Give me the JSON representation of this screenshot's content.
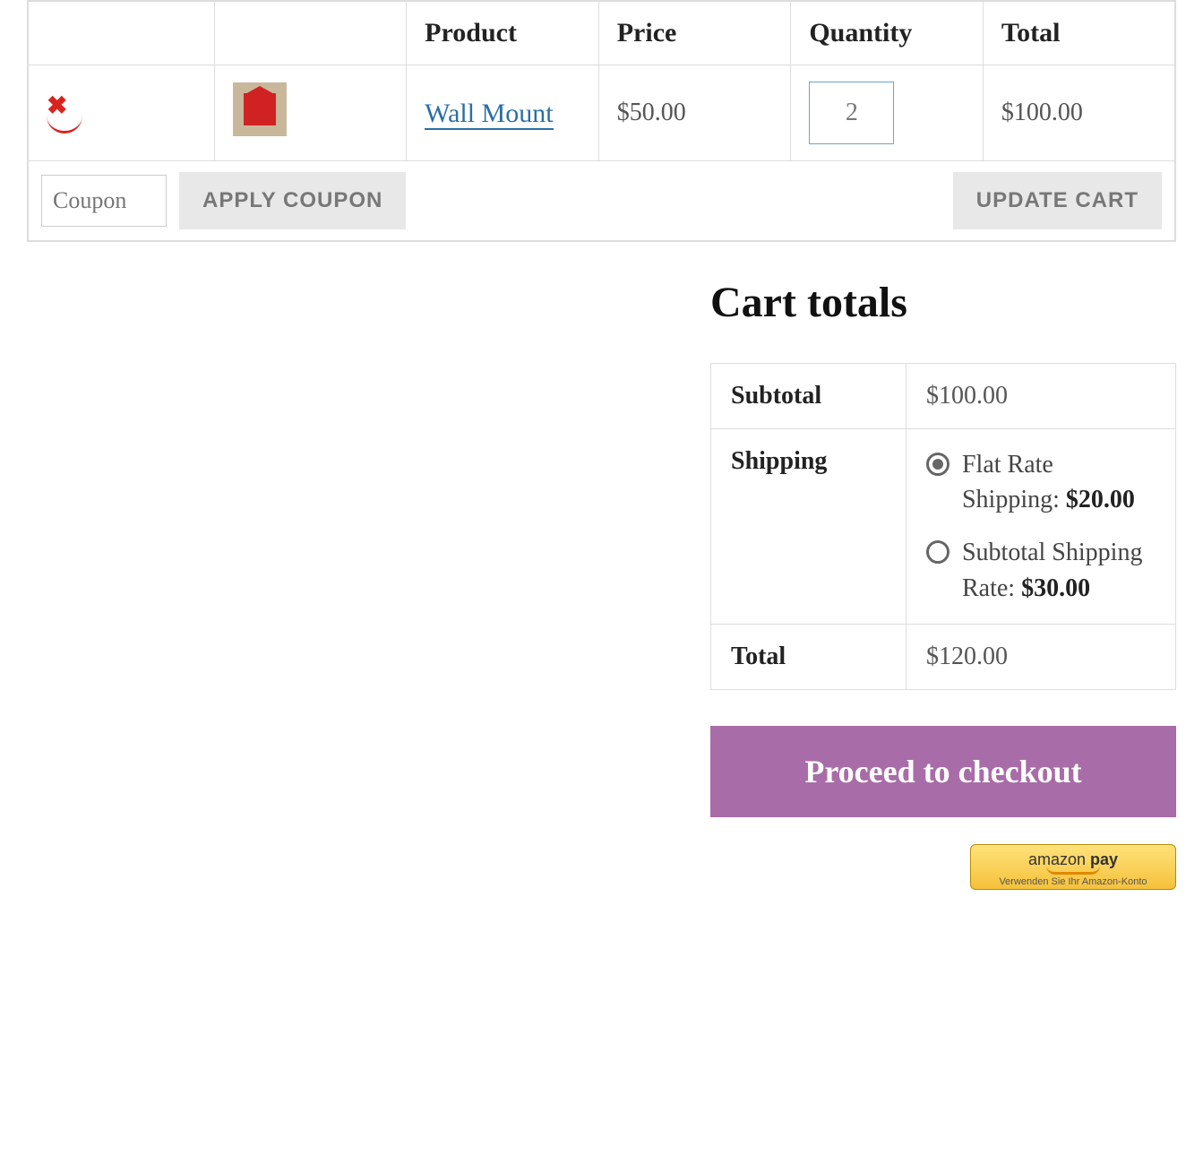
{
  "cart_table": {
    "headers": {
      "product": "Product",
      "price": "Price",
      "quantity": "Quantity",
      "total": "Total"
    },
    "item": {
      "remove_symbol": "✖",
      "product_name": "Wall Mount",
      "price": "$50.00",
      "quantity": "2",
      "line_total": "$100.00"
    },
    "coupon_placeholder": "Coupon",
    "apply_coupon_label": "APPLY COUPON",
    "update_cart_label": "UPDATE CART"
  },
  "totals": {
    "heading": "Cart totals",
    "subtotal_label": "Subtotal",
    "subtotal_value": "$100.00",
    "shipping_label": "Shipping",
    "shipping_options": [
      {
        "label": "Flat Rate Shipping: ",
        "price": "$20.00",
        "checked": true
      },
      {
        "label": "Subtotal Shipping Rate: ",
        "price": "$30.00",
        "checked": false
      }
    ],
    "total_label": "Total",
    "total_value": "$120.00",
    "checkout_label": "Proceed to checkout"
  },
  "amazon": {
    "brand_prefix": "amazon",
    "brand_suffix": " pay",
    "subtext": "Verwenden Sie Ihr Amazon-Konto"
  }
}
